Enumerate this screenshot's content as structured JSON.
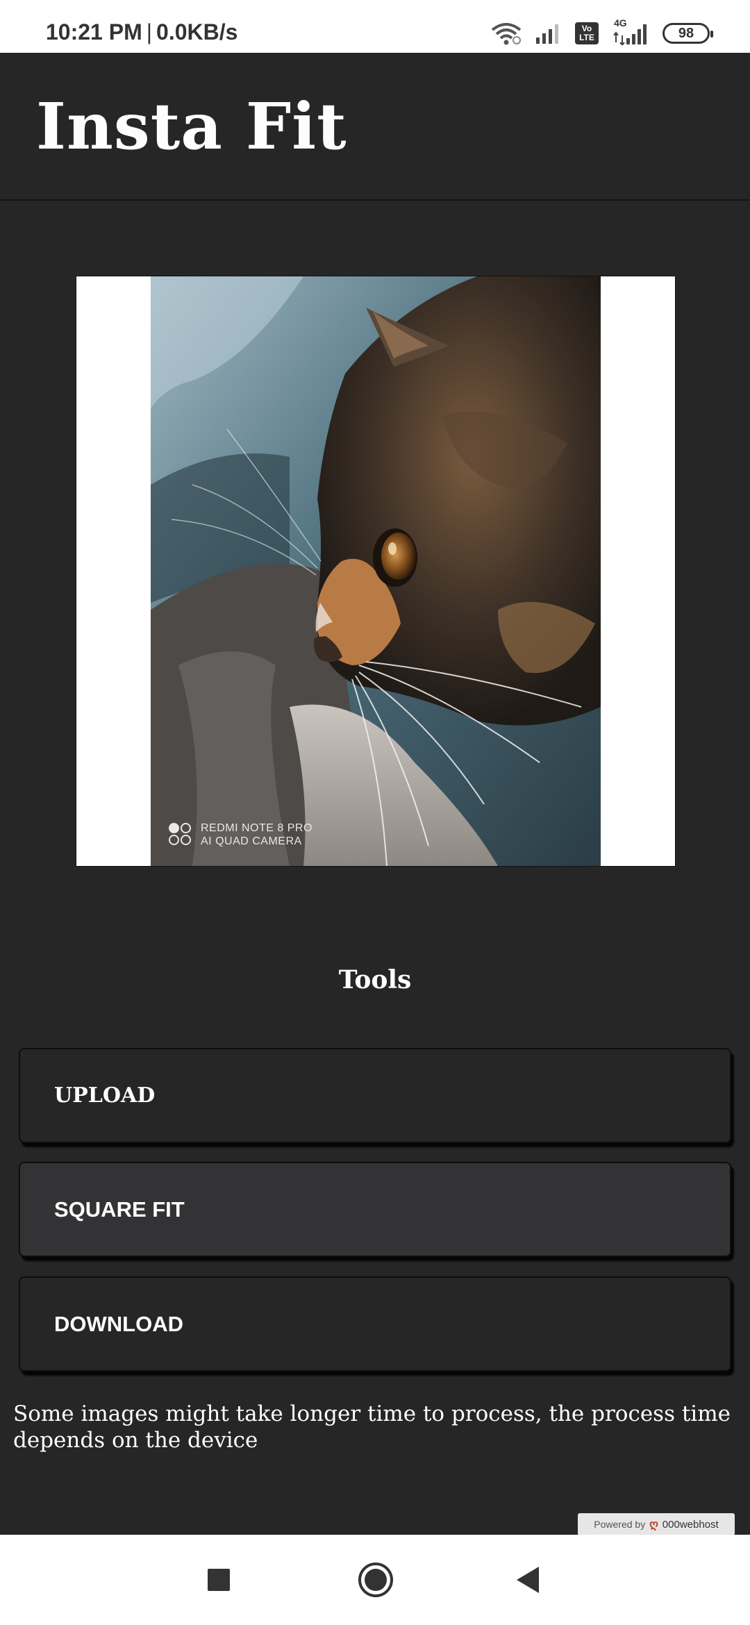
{
  "status_bar": {
    "time": "10:21 PM",
    "separator": "|",
    "speed": "0.0KB/s",
    "volte_label": "Vo LTE",
    "network_label": "4G",
    "battery": "98"
  },
  "app": {
    "title": "Insta Fit"
  },
  "preview": {
    "watermark_line1": "REDMI NOTE 8 PRO",
    "watermark_line2": "AI QUAD CAMERA"
  },
  "tools": {
    "heading": "Tools",
    "upload_label": "UPLOAD",
    "square_fit_label": "SQUARE FIT",
    "download_label": "DOWNLOAD"
  },
  "notice": "Some images might take longer time to process, the process time depends on the device",
  "footer": {
    "powered_by": "Powered by",
    "host_brand": "000webhost"
  },
  "colors": {
    "background": "#262627",
    "status_bar": "#ffffff",
    "text": "#ffffff",
    "button_active": "#333335"
  }
}
